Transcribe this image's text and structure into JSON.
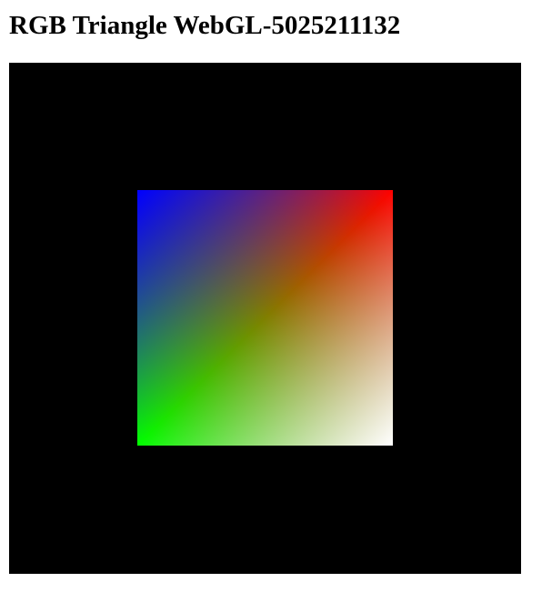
{
  "page": {
    "title": "RGB Triangle WebGL-5025211132"
  },
  "canvas": {
    "background_color": "#000000",
    "corner_colors": {
      "top_left": "#0000ff",
      "top_right": "#ff0000",
      "bottom_left": "#00ff00",
      "bottom_right": "#ffffff"
    }
  }
}
